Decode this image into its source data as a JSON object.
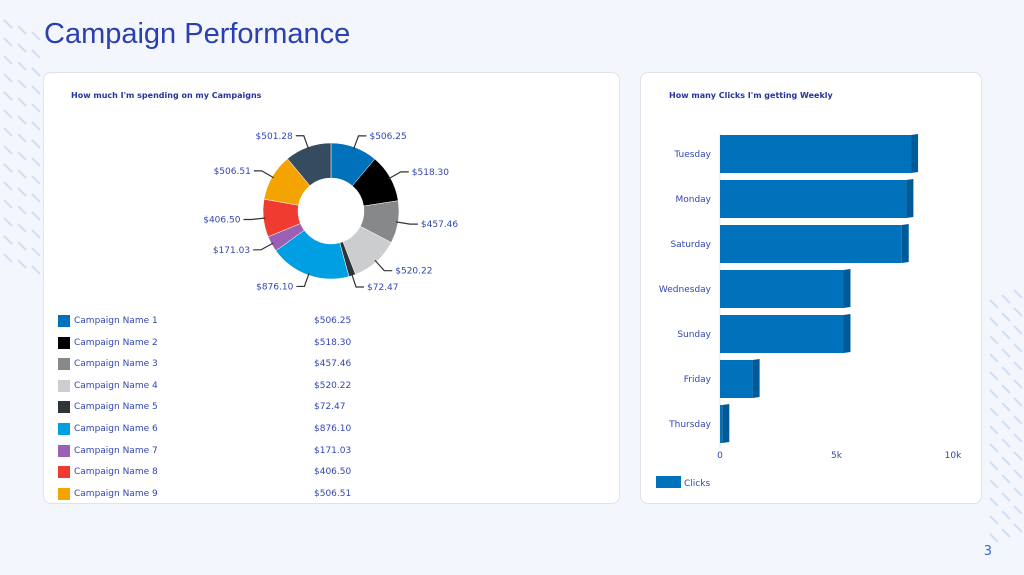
{
  "page": {
    "title": "Campaign Performance",
    "page_number": "3"
  },
  "spend_chart": {
    "title": "How much I'm spending on my Campaigns"
  },
  "clicks_chart": {
    "title": "How many Clicks I'm getting Weekly"
  },
  "chart_data": [
    {
      "type": "pie",
      "donut": true,
      "title": "How much I'm spending on my Campaigns",
      "slices": [
        {
          "name": "Campaign Name 1",
          "value": 506.25,
          "label": "$506.25",
          "color": "#0071bb"
        },
        {
          "name": "Campaign Name 2",
          "value": 518.3,
          "label": "$518.30",
          "color": "#000000"
        },
        {
          "name": "Campaign Name 3",
          "value": 457.46,
          "label": "$457.46",
          "color": "#86888a"
        },
        {
          "name": "Campaign Name 4",
          "value": 520.22,
          "label": "$520.22",
          "color": "#cbcdcf"
        },
        {
          "name": "Campaign Name 5",
          "value": 72.47,
          "label": "$72.47",
          "color": "#2f3438"
        },
        {
          "name": "Campaign Name 6",
          "value": 876.1,
          "label": "$876.10",
          "color": "#009fe3"
        },
        {
          "name": "Campaign Name 7",
          "value": 171.03,
          "label": "$171.03",
          "color": "#9b5fb4"
        },
        {
          "name": "Campaign Name 8",
          "value": 406.5,
          "label": "$406.50",
          "color": "#f03b30"
        },
        {
          "name": "Campaign Name 9",
          "value": 506.51,
          "label": "$506.51",
          "color": "#f3a400"
        },
        {
          "value": 501.28,
          "label": "$501.28",
          "color": "#354b60"
        }
      ],
      "legend_placement": "bottom"
    },
    {
      "type": "bar",
      "orientation": "horizontal",
      "title": "How many Clicks I'm getting Weekly",
      "categories": [
        "Tuesday",
        "Monday",
        "Saturday",
        "Wednesday",
        "Sunday",
        "Friday",
        "Thursday"
      ],
      "series": [
        {
          "name": "Clicks",
          "values": [
            8500,
            8300,
            8100,
            5600,
            5600,
            1700,
            400
          ],
          "color": "#0071bb"
        }
      ],
      "xlim": [
        0,
        10000
      ],
      "xticks": [
        "0",
        "5k",
        "10k"
      ],
      "grid": false,
      "legend_placement": "bottom-left"
    }
  ]
}
